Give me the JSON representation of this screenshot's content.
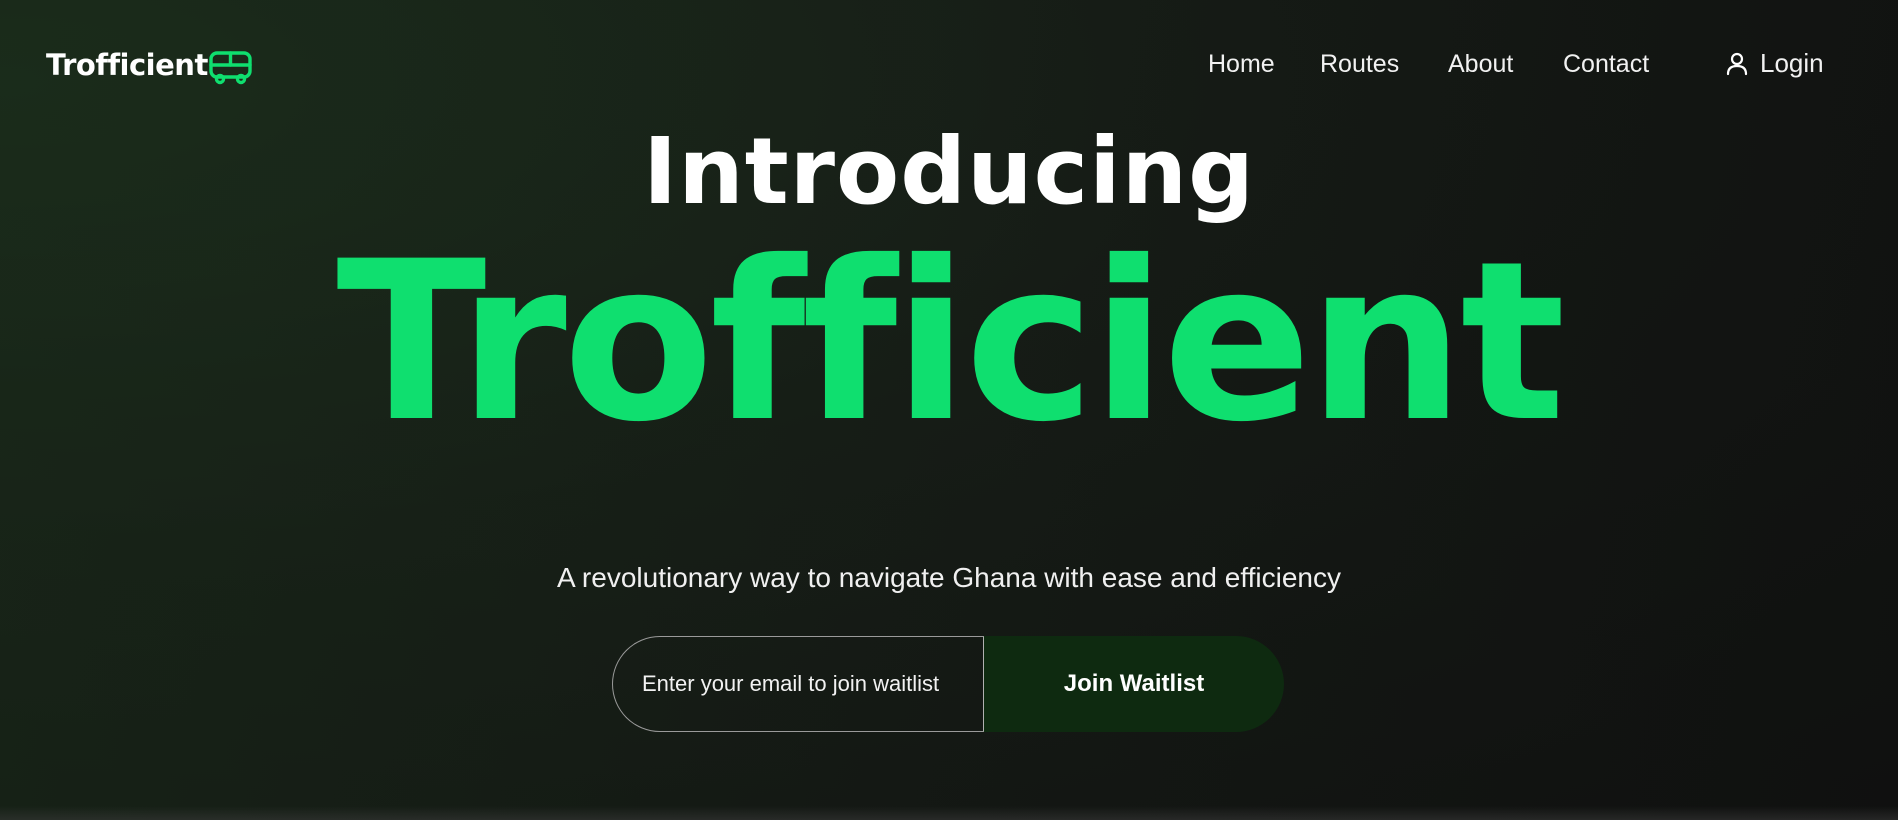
{
  "header": {
    "logo_text": "Trofficient",
    "logo_icon": "bus-icon",
    "nav": [
      {
        "label": "Home"
      },
      {
        "label": "Routes"
      },
      {
        "label": "About"
      },
      {
        "label": "Contact"
      }
    ],
    "login_label": "Login",
    "login_icon": "user-icon"
  },
  "hero": {
    "intro": "Introducing",
    "brand": "Trofficient",
    "subtitle": "A revolutionary way to navigate Ghana with ease and efficiency",
    "email_placeholder": "Enter your email to join waitlist",
    "email_value": "",
    "cta_label": "Join Waitlist"
  },
  "colors": {
    "accent": "#0fdf6f",
    "button_bg": "#0e2a10",
    "background": "#161a16",
    "text": "#ffffff"
  }
}
